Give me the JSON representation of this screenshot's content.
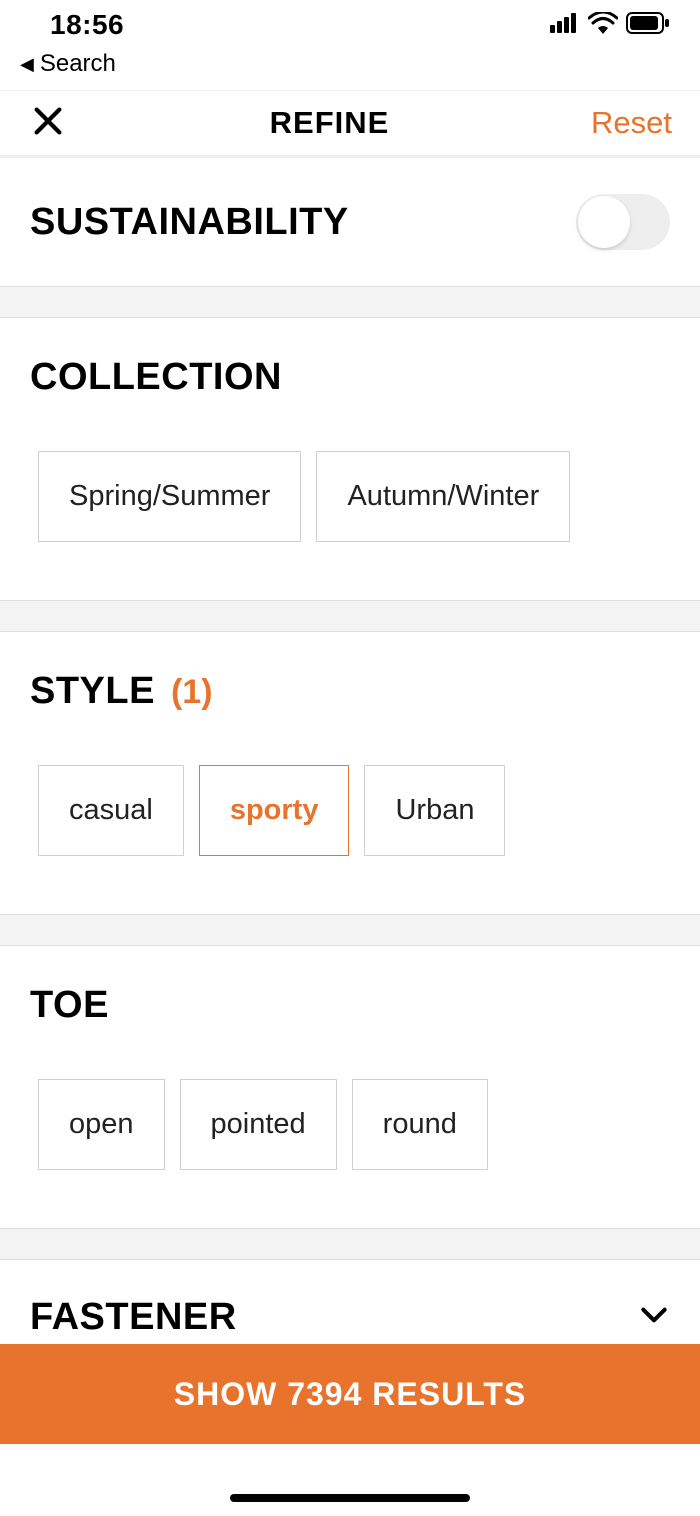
{
  "status": {
    "time": "18:56",
    "back_label": "Search"
  },
  "header": {
    "title": "REFINE",
    "reset_label": "Reset"
  },
  "sections": {
    "sustainability": {
      "title": "SUSTAINABILITY",
      "toggle_on": false
    },
    "collection": {
      "title": "COLLECTION",
      "options": [
        "Spring/Summer",
        "Autumn/Winter"
      ]
    },
    "style": {
      "title": "STYLE",
      "count_label": "(1)",
      "options": [
        "casual",
        "sporty",
        "Urban"
      ],
      "selected": "sporty"
    },
    "toe": {
      "title": "TOE",
      "options": [
        "open",
        "pointed",
        "round"
      ]
    },
    "fastener": {
      "title": "FASTENER"
    }
  },
  "footer": {
    "show_results_label": "SHOW 7394 RESULTS"
  }
}
